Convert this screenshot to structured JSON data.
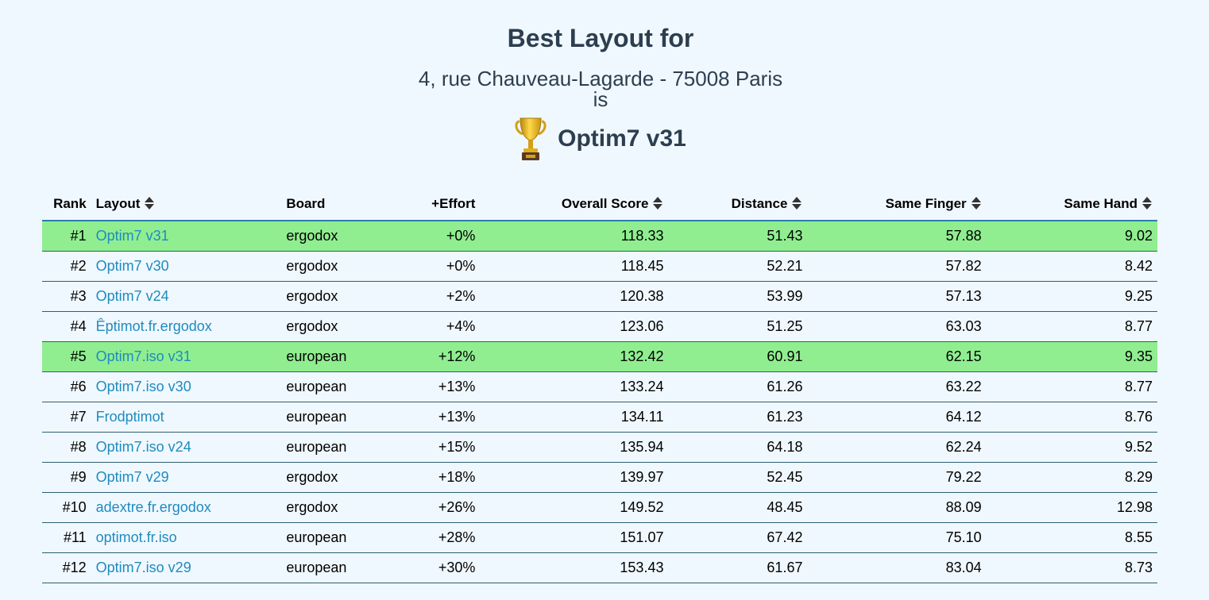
{
  "header": {
    "title": "Best Layout for",
    "address": "4, rue Chauveau-Lagarde - 75008 Paris",
    "is_word": "is",
    "winner": "Optim7 v31",
    "trophy_icon": "trophy-icon"
  },
  "table": {
    "columns": {
      "rank": "Rank",
      "layout": "Layout",
      "board": "Board",
      "effort": "+Effort",
      "overall_score": "Overall Score",
      "distance": "Distance",
      "same_finger": "Same Finger",
      "same_hand": "Same Hand"
    },
    "sortable_icon": "sort-up-down-icon",
    "highlight_color": "#90ee90",
    "link_color": "#1e8bbf",
    "rows": [
      {
        "rank": "#1",
        "layout": "Optim7 v31",
        "board": "ergodox",
        "effort": "+0%",
        "overall_score": "118.33",
        "distance": "51.43",
        "same_finger": "57.88",
        "same_hand": "9.02",
        "highlighted": true
      },
      {
        "rank": "#2",
        "layout": "Optim7 v30",
        "board": "ergodox",
        "effort": "+0%",
        "overall_score": "118.45",
        "distance": "52.21",
        "same_finger": "57.82",
        "same_hand": "8.42",
        "highlighted": false
      },
      {
        "rank": "#3",
        "layout": "Optim7 v24",
        "board": "ergodox",
        "effort": "+2%",
        "overall_score": "120.38",
        "distance": "53.99",
        "same_finger": "57.13",
        "same_hand": "9.25",
        "highlighted": false
      },
      {
        "rank": "#4",
        "layout": "Êptimot.fr.ergodox",
        "board": "ergodox",
        "effort": "+4%",
        "overall_score": "123.06",
        "distance": "51.25",
        "same_finger": "63.03",
        "same_hand": "8.77",
        "highlighted": false
      },
      {
        "rank": "#5",
        "layout": "Optim7.iso v31",
        "board": "european",
        "effort": "+12%",
        "overall_score": "132.42",
        "distance": "60.91",
        "same_finger": "62.15",
        "same_hand": "9.35",
        "highlighted": true
      },
      {
        "rank": "#6",
        "layout": "Optim7.iso v30",
        "board": "european",
        "effort": "+13%",
        "overall_score": "133.24",
        "distance": "61.26",
        "same_finger": "63.22",
        "same_hand": "8.77",
        "highlighted": false
      },
      {
        "rank": "#7",
        "layout": "Frodptimot",
        "board": "european",
        "effort": "+13%",
        "overall_score": "134.11",
        "distance": "61.23",
        "same_finger": "64.12",
        "same_hand": "8.76",
        "highlighted": false
      },
      {
        "rank": "#8",
        "layout": "Optim7.iso v24",
        "board": "european",
        "effort": "+15%",
        "overall_score": "135.94",
        "distance": "64.18",
        "same_finger": "62.24",
        "same_hand": "9.52",
        "highlighted": false
      },
      {
        "rank": "#9",
        "layout": "Optim7 v29",
        "board": "ergodox",
        "effort": "+18%",
        "overall_score": "139.97",
        "distance": "52.45",
        "same_finger": "79.22",
        "same_hand": "8.29",
        "highlighted": false
      },
      {
        "rank": "#10",
        "layout": "adextre.fr.ergodox",
        "board": "ergodox",
        "effort": "+26%",
        "overall_score": "149.52",
        "distance": "48.45",
        "same_finger": "88.09",
        "same_hand": "12.98",
        "highlighted": false
      },
      {
        "rank": "#11",
        "layout": "optimot.fr.iso",
        "board": "european",
        "effort": "+28%",
        "overall_score": "151.07",
        "distance": "67.42",
        "same_finger": "75.10",
        "same_hand": "8.55",
        "highlighted": false
      },
      {
        "rank": "#12",
        "layout": "Optim7.iso v29",
        "board": "european",
        "effort": "+30%",
        "overall_score": "153.43",
        "distance": "61.67",
        "same_finger": "83.04",
        "same_hand": "8.73",
        "highlighted": false
      }
    ]
  }
}
